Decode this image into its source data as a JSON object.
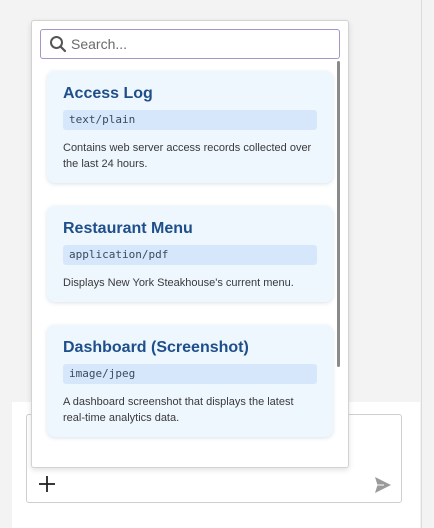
{
  "search": {
    "placeholder": "Search...",
    "value": ""
  },
  "resources": [
    {
      "title": "Access Log",
      "mime": "text/plain",
      "description": "Contains web server access records collected over the last 24 hours."
    },
    {
      "title": "Restaurant Menu",
      "mime": "application/pdf",
      "description": "Displays New York Steakhouse's current menu."
    },
    {
      "title": "Dashboard (Screenshot)",
      "mime": "image/jpeg",
      "description": "A dashboard screenshot that displays the latest real-time analytics data."
    }
  ],
  "composer": {
    "value": ""
  },
  "colors": {
    "accent": "#1f4f8a",
    "card_background": "#eef6fe",
    "mime_background": "#d7e7fb",
    "search_border": "#a596c4"
  },
  "icons": {
    "search": "search-icon",
    "add": "plus-icon",
    "send": "send-icon"
  }
}
